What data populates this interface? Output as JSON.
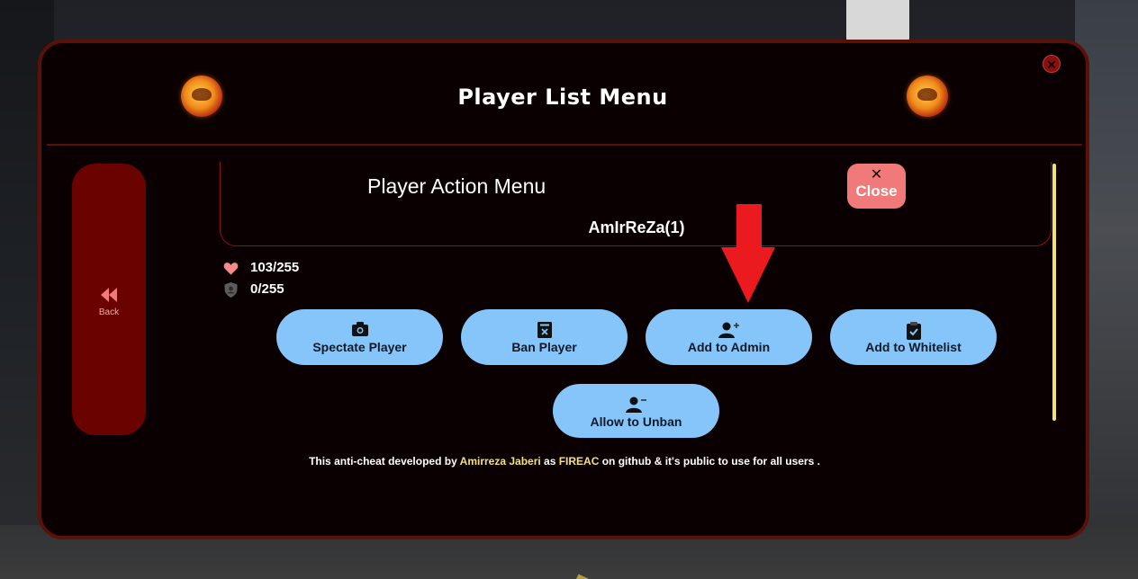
{
  "window": {
    "title": "Player List Menu"
  },
  "sidebar": {
    "back_label": "Back"
  },
  "action_menu": {
    "title": "Player Action Menu",
    "close_label": "Close",
    "player_name": "AmIrReZa(1)"
  },
  "stats": {
    "health": "103/255",
    "armor": "0/255"
  },
  "actions": [
    {
      "label": "Spectate Player",
      "icon": "camera-icon"
    },
    {
      "label": "Ban Player",
      "icon": "ban-icon"
    },
    {
      "label": "Add to Admin",
      "icon": "user-plus-icon"
    },
    {
      "label": "Add to Whitelist",
      "icon": "clipboard-check-icon"
    },
    {
      "label": "Allow to Unban",
      "icon": "user-minus-icon"
    }
  ],
  "footer": {
    "prefix": "This anti-cheat developed by ",
    "author": "Amirreza Jaberi",
    "middle1": " as ",
    "project": "FIREAC",
    "suffix": " on github & it's public to use for all users ."
  },
  "colors": {
    "panel_bg": "#0a0001",
    "panel_border": "#5a1108",
    "action_button": "#86c5f9",
    "close_button": "#f07a7a",
    "back_button": "#6a0300",
    "highlight": "#f3e27a"
  }
}
